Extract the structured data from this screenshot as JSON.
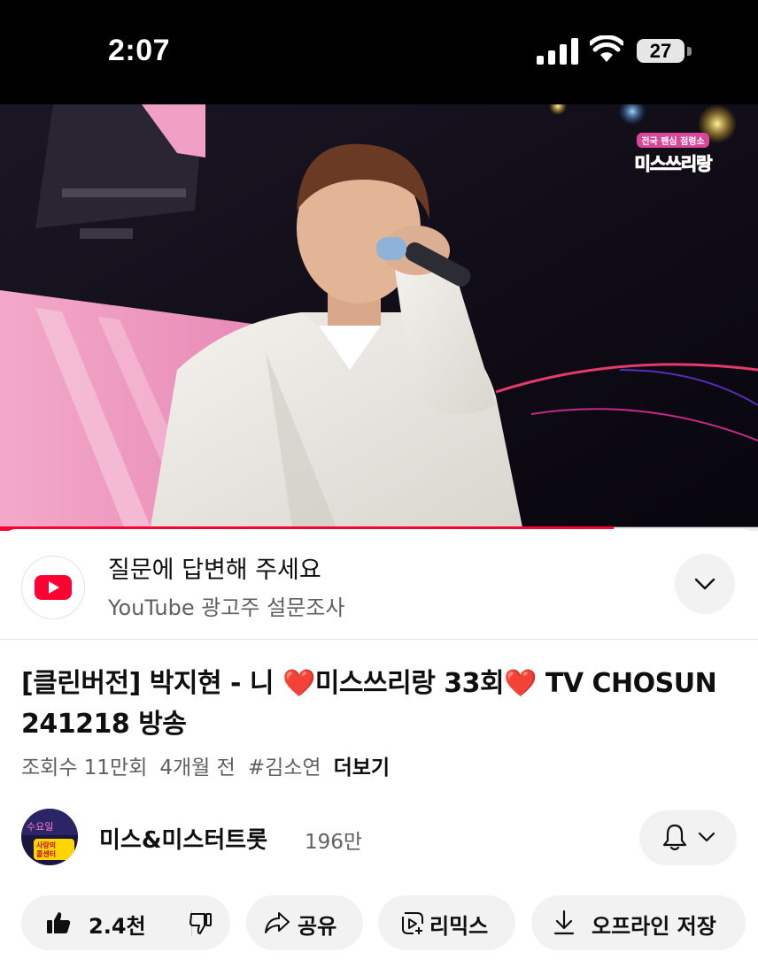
{
  "status_bar": {
    "time": "2:07",
    "battery": "27",
    "icons": [
      "signal-icon",
      "wifi-icon",
      "battery-icon"
    ]
  },
  "video": {
    "overlay_logo_sub": "전국 팬심 점령소",
    "overlay_logo_main": "미스쓰리랑",
    "progress_fraction": 0.81,
    "progress_color": "#ff0033"
  },
  "survey": {
    "title": "질문에 답변해 주세요",
    "subtitle": "YouTube 광고주 설문조사",
    "icons": [
      "youtube-logo-icon",
      "chevron-down-icon"
    ]
  },
  "title": {
    "part1": "[클린버전] 박지현 - 니 ",
    "heart1": "❤️",
    "part2": "미스쓰리랑 33회",
    "heart2": "❤️",
    "part3": " TV CHOSUN 241218 방송"
  },
  "meta": {
    "views": "조회수 11만회",
    "age": "4개월 전",
    "hashtag": "#김소연",
    "more": "더보기"
  },
  "channel": {
    "name": "미스&미스터트롯",
    "subscribers": "196만",
    "icons": [
      "channel-avatar",
      "bell-icon",
      "chevron-down-icon"
    ]
  },
  "actions": {
    "like_count": "2.4천",
    "share": "공유",
    "remix": "리믹스",
    "download": "오프라인 저장",
    "icons": [
      "thumbs-up-icon",
      "thumbs-down-icon",
      "share-icon",
      "remix-icon",
      "download-icon"
    ]
  },
  "colors": {
    "brand_red": "#ff0033",
    "heart": "#e0162b",
    "pill_bg": "#f2f2f2"
  }
}
